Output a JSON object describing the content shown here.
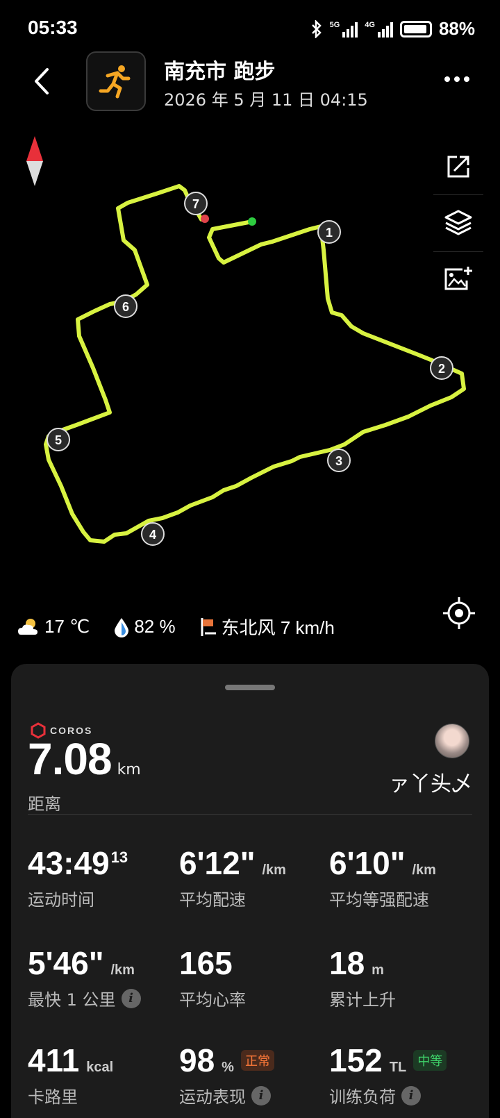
{
  "status_bar": {
    "time": "05:33",
    "signal_1": "5G",
    "signal_2": "4G",
    "battery": "88%"
  },
  "header": {
    "title": "南充市 跑步",
    "subtitle": "2026 年 5 月 11 日 04:15",
    "sport_icon": "running-person-icon",
    "accent_color": "#f5a623"
  },
  "map": {
    "route_color": "#d8f241",
    "start_color": "#2ecc40",
    "end_color": "#e0424a",
    "markers": [
      "1",
      "2",
      "3",
      "4",
      "5",
      "6",
      "7"
    ]
  },
  "weather": {
    "temperature": "17 ℃",
    "humidity": "82 %",
    "wind": "东北风 7 km/h"
  },
  "summary": {
    "brand": "COROS",
    "distance": "7.08",
    "distance_unit": "km",
    "distance_label": "距离",
    "username": "ァ丫头乄"
  },
  "stats": [
    {
      "value": "43:49",
      "sup": "13",
      "unit": "",
      "label": "运动时间"
    },
    {
      "value": "6'12\"",
      "unit": "/km",
      "label": "平均配速"
    },
    {
      "value": "6'10\"",
      "unit": "/km",
      "label": "平均等强配速"
    },
    {
      "value": "5'46\"",
      "unit": "/km",
      "label": "最快 1 公里"
    },
    {
      "value": "165",
      "unit": "",
      "label": "平均心率"
    },
    {
      "value": "18",
      "unit": "m",
      "label": "累计上升"
    },
    {
      "value": "411",
      "unit": "kcal",
      "label": "卡路里"
    },
    {
      "value": "98",
      "unit": "%",
      "badge": "正常",
      "label": "运动表现"
    },
    {
      "value": "152",
      "unit": "TL",
      "badge": "中等",
      "label": "训练负荷"
    }
  ]
}
